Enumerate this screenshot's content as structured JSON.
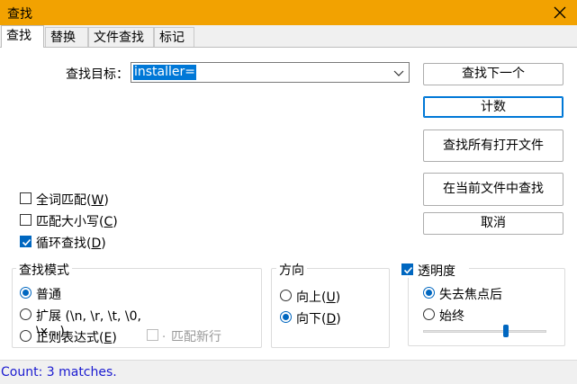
{
  "window": {
    "title": "查找"
  },
  "tabs": [
    {
      "label": "查找",
      "active": true
    },
    {
      "label": "替换",
      "active": false
    },
    {
      "label": "文件查找",
      "active": false
    },
    {
      "label": "标记",
      "active": false
    }
  ],
  "search": {
    "label": "查找目标：",
    "value": "installer="
  },
  "buttons": {
    "find_next": "查找下一个",
    "count": "计数",
    "find_all_open": "查找所有打开文件",
    "find_in_current": "在当前文件中查找",
    "cancel": "取消"
  },
  "options": {
    "whole_word": {
      "prefix": "全词匹配(",
      "key": "W",
      "suffix": ")",
      "checked": false
    },
    "match_case": {
      "prefix": "匹配大小写(",
      "key": "C",
      "suffix": ")",
      "checked": false
    },
    "wrap_around": {
      "prefix": "循环查找(",
      "key": "D",
      "suffix": ")",
      "checked": true
    }
  },
  "search_mode": {
    "title": "查找模式",
    "normal": "普通",
    "extended": {
      "prefix": "扩展 (\\n, \\r, \\t, \\0, \\x...)"
    },
    "regex": {
      "prefix": "正则表达式(",
      "key": "E",
      "suffix": ")"
    },
    "newline_key": ".",
    "newline_label": "匹配新行",
    "selected": "normal"
  },
  "direction": {
    "title": "方向",
    "up": {
      "prefix": "向上(",
      "key": "U",
      "suffix": ")"
    },
    "down": {
      "prefix": "向下(",
      "key": "D",
      "suffix": ")"
    },
    "selected": "down"
  },
  "transparency": {
    "title": "透明度",
    "checked": true,
    "on_lose_focus": "失去焦点后",
    "always": "始终",
    "selected": "on_lose_focus",
    "level": 0.67
  },
  "status": {
    "text": "Count: 3 matches."
  },
  "colors": {
    "titlebar": "#f2a201",
    "accent": "#0067c0",
    "status_text": "#1a1ad0"
  }
}
